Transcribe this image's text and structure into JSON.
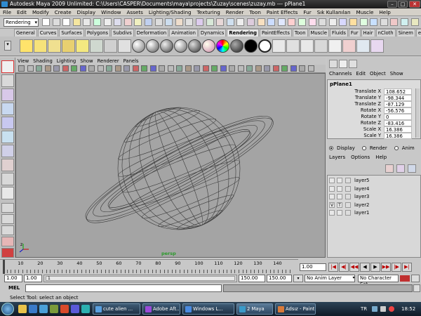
{
  "window": {
    "title": "Autodesk Maya 2009 Unlimited: C:\\Users\\CASPER\\Documents\\maya\\projects\\Zuzay\\scenes\\zuzay.mb  ---  pPlane1",
    "minimize": "–",
    "maximize": "□",
    "close": "✕"
  },
  "menu": [
    "File",
    "Edit",
    "Modify",
    "Create",
    "Display",
    "Window",
    "Assets",
    "Lighting/Shading",
    "Texturing",
    "Render",
    "Toon",
    "Paint Effects",
    "Fur",
    "Sık Kullanılan",
    "Muscle",
    "Help"
  ],
  "menu_set": "Rendering",
  "shelf_tabs": [
    "General",
    "Curves",
    "Surfaces",
    "Polygons",
    "Subdivs",
    "Deformation",
    "Animation",
    "Dynamics",
    "Rendering",
    "PaintEffects",
    "Toon",
    "Muscle",
    "Fluids",
    "Fur",
    "Hair",
    "nCloth",
    "Sinem",
    "ersin"
  ],
  "active_shelf_tab": "Rendering",
  "viewport": {
    "menu": [
      "View",
      "Shading",
      "Lighting",
      "Show",
      "Renderer",
      "Panels"
    ],
    "camera_label": "persp",
    "axis_label": "z"
  },
  "channel_box": {
    "menu": [
      "Channels",
      "Edit",
      "Object",
      "Show"
    ],
    "object_name": "pPlane1",
    "attributes": [
      {
        "name": "Translate X",
        "value": "108.652"
      },
      {
        "name": "Translate Y",
        "value": "-98.344"
      },
      {
        "name": "Translate Z",
        "value": "-87.129"
      },
      {
        "name": "Rotate X",
        "value": "-56.576"
      },
      {
        "name": "Rotate Y",
        "value": "0"
      },
      {
        "name": "Rotate Z",
        "value": "-83.416"
      },
      {
        "name": "Scale X",
        "value": "16.386"
      },
      {
        "name": "Scale Y",
        "value": "16.386"
      }
    ]
  },
  "layer_editor": {
    "modes": [
      "Display",
      "Render",
      "Anim"
    ],
    "selected_mode": "Display",
    "menu": [
      "Layers",
      "Options",
      "Help"
    ],
    "layers": [
      {
        "name": "layer5",
        "v": "",
        "t": ""
      },
      {
        "name": "layer4",
        "v": "",
        "t": ""
      },
      {
        "name": "layer3",
        "v": "",
        "t": ""
      },
      {
        "name": "layer2",
        "v": "V",
        "t": "T"
      },
      {
        "name": "layer1",
        "v": "",
        "t": ""
      }
    ]
  },
  "timeline": {
    "labels": [
      "10",
      "20",
      "30",
      "40",
      "50",
      "60",
      "70",
      "80",
      "90",
      "100",
      "110",
      "120",
      "130",
      "140"
    ],
    "current_frame": "1.00"
  },
  "range": {
    "start": "1.00",
    "playback_start": "1.00",
    "slider_value": "1",
    "playback_end": "150.00",
    "end": "150.00",
    "anim_layer": "No Anim Layer",
    "character_set": "No Character Set"
  },
  "command_line": {
    "mode": "MEL",
    "help_text": "Select Tool: select an object"
  },
  "taskbar": {
    "tasks": [
      "cute alien ...",
      "Adobe Aft...",
      "Windows L...",
      "2 Maya",
      "Adsız - Paint"
    ],
    "language": "TR",
    "clock": "18:52"
  },
  "colors": {
    "viewport_bg": "#a4a4a4",
    "wireframe": "#3a3a3a",
    "camera_label": "#2a9a2a"
  }
}
